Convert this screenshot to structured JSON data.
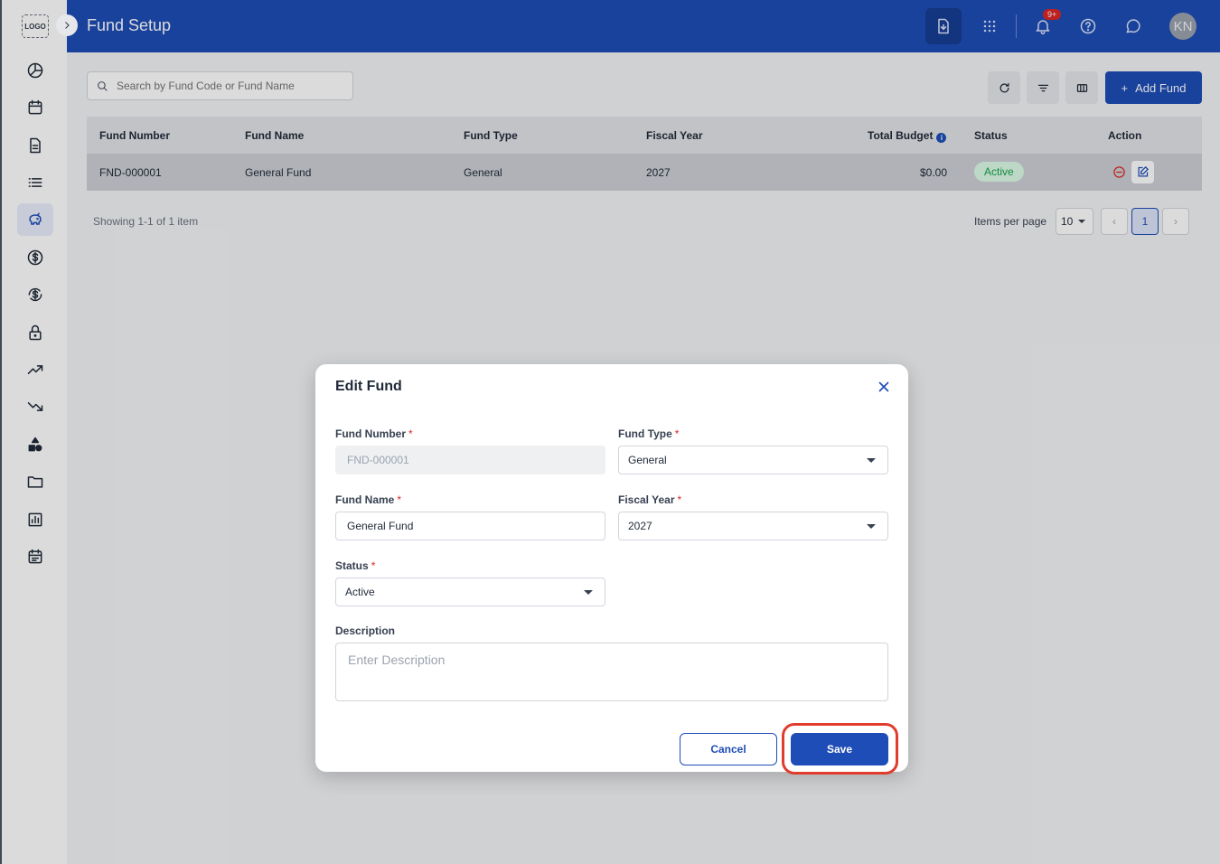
{
  "app": {
    "logo_text": "LOGO",
    "page_title": "Fund Setup"
  },
  "header": {
    "notification_count": "9+",
    "avatar_initials": "KN"
  },
  "sidebar": {
    "items": [
      {
        "icon": "pie-chart-icon"
      },
      {
        "icon": "calendar-icon"
      },
      {
        "icon": "document-icon"
      },
      {
        "icon": "list-icon"
      },
      {
        "icon": "piggy-bank-icon",
        "active": true
      },
      {
        "icon": "dollar-circle-icon"
      },
      {
        "icon": "dollar-refresh-icon"
      },
      {
        "icon": "lock-icon"
      },
      {
        "icon": "trending-up-icon"
      },
      {
        "icon": "trending-down-icon"
      },
      {
        "icon": "shapes-icon"
      },
      {
        "icon": "folder-icon"
      },
      {
        "icon": "bar-chart-icon"
      },
      {
        "icon": "event-calendar-icon"
      }
    ]
  },
  "toolbar": {
    "search_placeholder": "Search by Fund Code or Fund Name",
    "add_label": "Add Fund"
  },
  "table": {
    "columns": [
      "Fund Number",
      "Fund Name",
      "Fund Type",
      "Fiscal Year",
      "Total Budget",
      "Status",
      "Action"
    ],
    "rows": [
      {
        "fund_number": "FND-000001",
        "fund_name": "General Fund",
        "fund_type": "General",
        "fiscal_year": "2027",
        "total_budget": "$0.00",
        "status": "Active"
      }
    ]
  },
  "pagination": {
    "showing": "Showing 1-1 of 1 item",
    "items_per_page_label": "Items per page",
    "items_per_page": "10",
    "current_page": "1"
  },
  "modal": {
    "title": "Edit Fund",
    "fund_number_label": "Fund Number",
    "fund_number_value": "FND-000001",
    "fund_type_label": "Fund Type",
    "fund_type_value": "General",
    "fund_name_label": "Fund Name",
    "fund_name_value": "General Fund",
    "fiscal_year_label": "Fiscal Year",
    "fiscal_year_value": "2027",
    "status_label": "Status",
    "status_value": "Active",
    "description_label": "Description",
    "description_placeholder": "Enter Description",
    "required_mark": "*",
    "cancel_label": "Cancel",
    "save_label": "Save"
  },
  "colors": {
    "primary": "#1e4db7",
    "status_active_bg": "#dcfce7",
    "status_active_text": "#16a34a",
    "required": "#dc2626",
    "highlight_ring": "#e03d2f"
  }
}
